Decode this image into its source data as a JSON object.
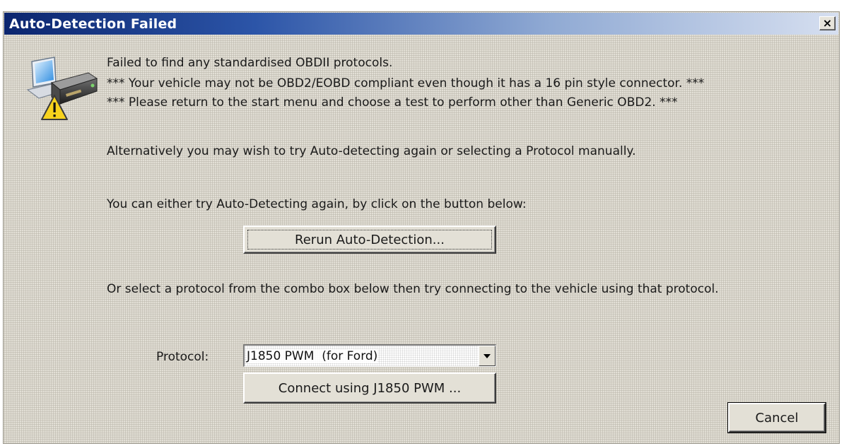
{
  "dialog": {
    "title": "Auto-Detection Failed",
    "close_glyph": "×"
  },
  "message": {
    "line1": "Failed to find any standardised OBDII protocols.",
    "line2": "*** Your vehicle may not be OBD2/EOBD compliant even though it has a 16 pin  style connector.  ***",
    "line3": "*** Please return to the start menu and choose a test to perform other than Generic OBD2. ***",
    "line4": "Alternatively you may  wish to try Auto-detecting again or selecting a Protocol manually.",
    "line5": "You can either try Auto-Detecting again, by click on the button below:",
    "line6": "Or select a protocol from the combo box below then try connecting to the vehicle using that protocol."
  },
  "buttons": {
    "rerun": "Rerun Auto-Detection...",
    "connect": "Connect using J1850 PWM ...",
    "cancel": "Cancel"
  },
  "protocol": {
    "label": "Protocol:",
    "selected": "J1850 PWM  (for Ford)"
  },
  "icons": {
    "app": "computer-device-warning-icon",
    "dropdown": "chevron-down-icon"
  },
  "colors": {
    "title_start": "#0b256e",
    "title_end": "#d6dff0",
    "dialog_bg": "#d8d4c8"
  }
}
